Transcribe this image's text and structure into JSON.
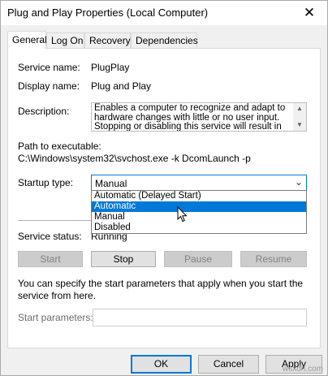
{
  "window": {
    "title": "Plug and Play Properties (Local Computer)"
  },
  "tabs": [
    {
      "label": "General",
      "active": true
    },
    {
      "label": "Log On",
      "active": false
    },
    {
      "label": "Recovery",
      "active": false
    },
    {
      "label": "Dependencies",
      "active": false
    }
  ],
  "general": {
    "service_name_label": "Service name:",
    "service_name": "PlugPlay",
    "display_name_label": "Display name:",
    "display_name": "Plug and Play",
    "description_label": "Description:",
    "description": "Enables a computer to recognize and adapt to hardware changes with little or no user input. Stopping or disabling this service will result in system",
    "path_label": "Path to executable:",
    "path": "C:\\Windows\\system32\\svchost.exe -k DcomLaunch -p",
    "startup_label": "Startup type:",
    "startup_value": "Manual",
    "startup_options": [
      {
        "label": "Automatic (Delayed Start)",
        "highlighted": false
      },
      {
        "label": "Automatic",
        "highlighted": true
      },
      {
        "label": "Manual",
        "highlighted": false
      },
      {
        "label": "Disabled",
        "highlighted": false
      }
    ],
    "status_label": "Service status:",
    "status_value": "Running",
    "buttons": {
      "start": "Start",
      "stop": "Stop",
      "pause": "Pause",
      "resume": "Resume"
    },
    "hint": "You can specify the start parameters that apply when you start the service from here.",
    "params_label": "Start parameters:",
    "params_value": ""
  },
  "dialog_buttons": {
    "ok": "OK",
    "cancel": "Cancel",
    "apply": "Apply"
  },
  "watermark": "wsxdn.com",
  "colors": {
    "accent": "#0078d7",
    "disabled_text": "#838383"
  }
}
